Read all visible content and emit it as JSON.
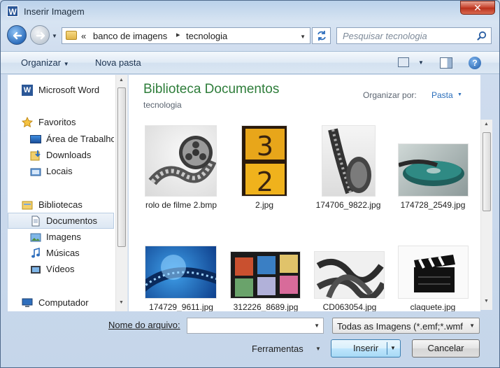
{
  "window": {
    "title": "Inserir Imagem",
    "app_icon_letter": "W",
    "close_glyph": "✕"
  },
  "nav": {
    "breadcrumb_overflow": "«",
    "breadcrumbs": [
      "banco de imagens",
      "tecnologia"
    ],
    "crumb_separator": "▸",
    "search_placeholder": "Pesquisar tecnologia"
  },
  "toolbar": {
    "organize_label": "Organizar",
    "new_folder_label": "Nova pasta"
  },
  "sidebar": {
    "items": [
      {
        "label": "Microsoft Word",
        "icon": "word-icon"
      },
      {
        "label": "Favoritos",
        "icon": "star-icon"
      },
      {
        "label": "Área de Trabalho",
        "icon": "desktop-icon"
      },
      {
        "label": "Downloads",
        "icon": "downloads-icon"
      },
      {
        "label": "Locais",
        "icon": "recent-places-icon"
      },
      {
        "label": "Bibliotecas",
        "icon": "libraries-icon"
      },
      {
        "label": "Documentos",
        "icon": "documents-icon",
        "selected": true
      },
      {
        "label": "Imagens",
        "icon": "pictures-icon"
      },
      {
        "label": "Músicas",
        "icon": "music-icon"
      },
      {
        "label": "Vídeos",
        "icon": "videos-icon"
      },
      {
        "label": "Computador",
        "icon": "computer-icon"
      }
    ]
  },
  "library": {
    "title": "Biblioteca Documentos",
    "subtitle": "tecnologia",
    "arrange_label": "Organizar por:",
    "arrange_value": "Pasta"
  },
  "files": [
    {
      "name": "rolo de filme 2.bmp",
      "thumb": "film-reel"
    },
    {
      "name": "2.jpg",
      "thumb": "countdown"
    },
    {
      "name": "174706_9822.jpg",
      "thumb": "film-strip-vertical"
    },
    {
      "name": "174728_2549.jpg",
      "thumb": "film-roll-teal"
    },
    {
      "name": "174729_9611.jpg",
      "thumb": "blue-film"
    },
    {
      "name": "312226_8689.jpg",
      "thumb": "film-frames"
    },
    {
      "name": "CD063054.jpg",
      "thumb": "tangled-film"
    },
    {
      "name": "claquete.jpg",
      "thumb": "clapperboard"
    }
  ],
  "footer": {
    "filename_label": "Nome do arquivo:",
    "filename_value": "",
    "filter_value": "Todas as Imagens (*.emf;*.wmf",
    "tools_label": "Ferramentas",
    "insert_label": "Inserir",
    "cancel_label": "Cancelar"
  },
  "colors": {
    "library_title": "#2e7d3a",
    "link": "#2a6ebb"
  }
}
